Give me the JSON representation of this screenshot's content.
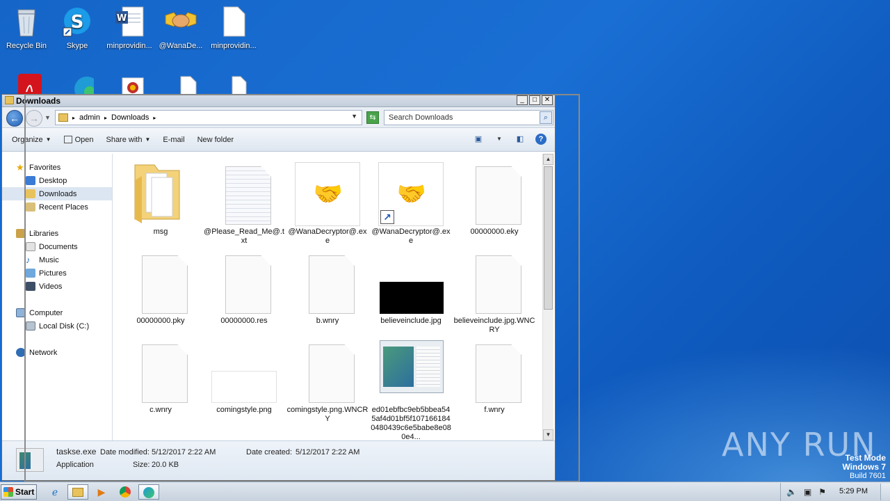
{
  "desktop": {
    "icons": [
      {
        "label": "Recycle Bin",
        "icon": "recycle-bin-icon"
      },
      {
        "label": "Skype",
        "icon": "skype-icon"
      },
      {
        "label": "minprovidin...",
        "icon": "word-doc-icon"
      },
      {
        "label": "@WanaDe...",
        "icon": "handshake-icon"
      },
      {
        "label": "minprovidin...",
        "icon": "blank-file-icon"
      }
    ],
    "row2_icons": [
      "acrobat-icon",
      "edge-icon",
      "image-file-icon",
      "blank-file-icon",
      "blank-file-icon"
    ]
  },
  "window": {
    "title": "Downloads",
    "breadcrumb": [
      "admin",
      "Downloads"
    ],
    "search_placeholder": "Search Downloads",
    "toolbar": {
      "organize": "Organize",
      "open": "Open",
      "share_with": "Share with",
      "email": "E-mail",
      "new_folder": "New folder"
    },
    "nav": {
      "favorites": "Favorites",
      "desktop": "Desktop",
      "downloads": "Downloads",
      "recent_places": "Recent Places",
      "libraries": "Libraries",
      "documents": "Documents",
      "music": "Music",
      "pictures": "Pictures",
      "videos": "Videos",
      "computer": "Computer",
      "local_disk": "Local Disk (C:)",
      "network": "Network"
    },
    "files": [
      {
        "name": "msg",
        "kind": "folder"
      },
      {
        "name": "@Please_Read_Me@.txt",
        "kind": "text"
      },
      {
        "name": "@WanaDecryptor@.exe",
        "kind": "exe"
      },
      {
        "name": "@WanaDecryptor@.exe",
        "kind": "exe-shortcut"
      },
      {
        "name": "00000000.eky",
        "kind": "blank"
      },
      {
        "name": "00000000.pky",
        "kind": "blank"
      },
      {
        "name": "00000000.res",
        "kind": "blank"
      },
      {
        "name": "b.wnry",
        "kind": "blank"
      },
      {
        "name": "believeinclude.jpg",
        "kind": "black-image"
      },
      {
        "name": "believeinclude.jpg.WNCRY",
        "kind": "blank"
      },
      {
        "name": "c.wnry",
        "kind": "blank"
      },
      {
        "name": "comingstyle.png",
        "kind": "white-image"
      },
      {
        "name": "comingstyle.png.WNCRY",
        "kind": "blank"
      },
      {
        "name": "ed01ebfbc9eb5bbea545af4d01bf5f1071661840480439c6e5babe8e080e4...",
        "kind": "exe-thumb"
      },
      {
        "name": "f.wnry",
        "kind": "blank"
      }
    ],
    "details": {
      "filename": "taskse.exe",
      "date_modified_label": "Date modified:",
      "date_modified": "5/12/2017 2:22 AM",
      "date_created_label": "Date created:",
      "date_created": "5/12/2017 2:22 AM",
      "type": "Application",
      "size_label": "Size:",
      "size": "20.0 KB"
    }
  },
  "taskbar": {
    "start": "Start",
    "clock": "5:29 PM"
  },
  "watermark": {
    "line1": "Test Mode",
    "line2": "Windows 7",
    "line3": "Build 7601",
    "brand": "ANY RUN"
  }
}
